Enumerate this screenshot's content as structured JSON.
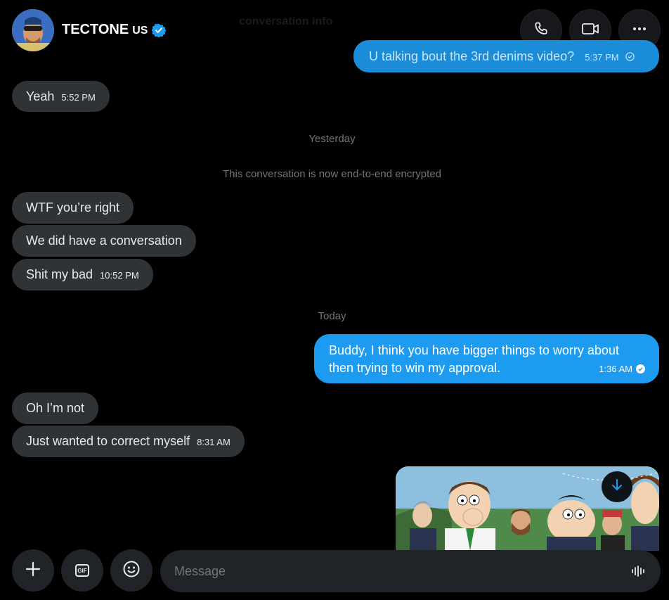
{
  "header": {
    "name": "TECTONE",
    "country": "US",
    "faded_text": "conversation info"
  },
  "messages": {
    "m1": {
      "text": "U talking bout the 3rd denims video?",
      "time": "5:37 PM"
    },
    "m2": {
      "text": "Yeah",
      "time": "5:52 PM"
    },
    "sep_yesterday": "Yesterday",
    "encrypted_notice": "This conversation is now end-to-end encrypted",
    "m3": {
      "text": "WTF you’re right"
    },
    "m4": {
      "text": "We did have a conversation"
    },
    "m5": {
      "text": "Shit my bad",
      "time": "10:52 PM"
    },
    "sep_today": "Today",
    "m6": {
      "line1": "Buddy, I think you have bigger things to worry about",
      "line2": "then trying to win my approval.",
      "time": "1:36 AM"
    },
    "m7": {
      "text": "Oh I’m not"
    },
    "m8": {
      "text": "Just wanted to correct myself",
      "time": "8:31 AM"
    }
  },
  "composer": {
    "placeholder": "Message",
    "gif_label": "GIF"
  },
  "colors": {
    "accent": "#1d9bf0",
    "incoming_bubble": "#2f3336",
    "background": "#000000"
  },
  "icons": [
    "phone-icon",
    "video-icon",
    "more-icon",
    "verified-icon",
    "plus-icon",
    "gif-icon",
    "emoji-icon",
    "voice-icon",
    "download-icon",
    "check-icon"
  ]
}
